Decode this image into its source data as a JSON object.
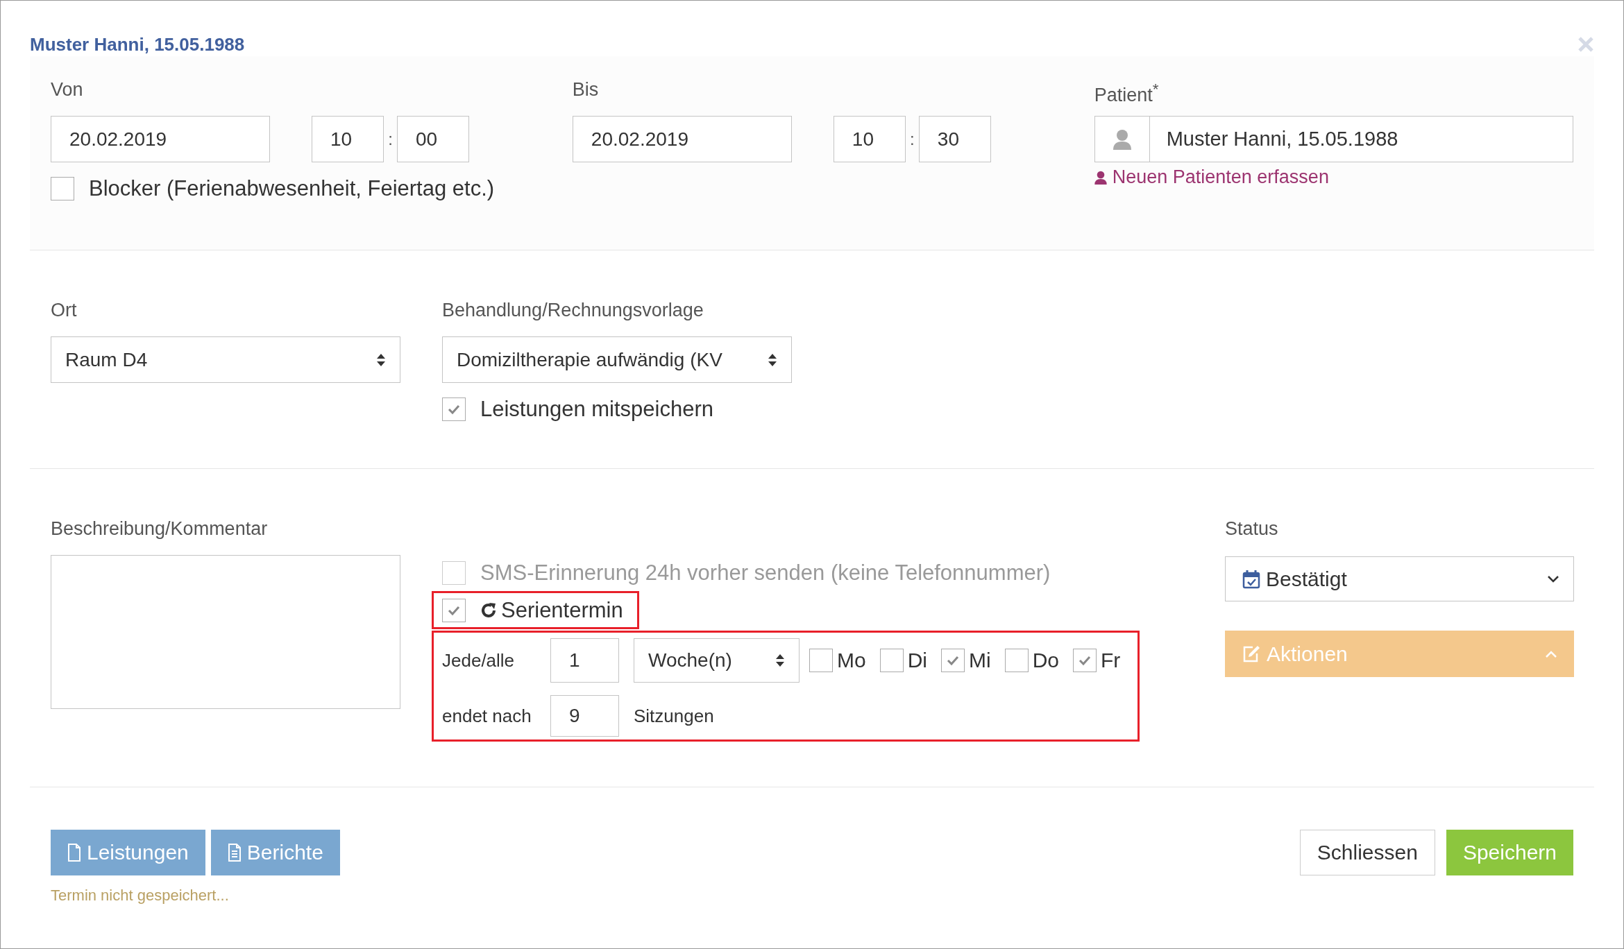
{
  "dialog": {
    "title": "Muster Hanni, 15.05.1988"
  },
  "von": {
    "label": "Von",
    "date": "20.02.2019",
    "hour": "10",
    "separator": ":",
    "minute": "00"
  },
  "bis": {
    "label": "Bis",
    "date": "20.02.2019",
    "hour": "10",
    "separator": ":",
    "minute": "30"
  },
  "patient": {
    "label": "Patient",
    "required_mark": "*",
    "value": "Muster Hanni, 15.05.1988",
    "new_patient_link": "Neuen Patienten erfassen"
  },
  "blocker": {
    "label": "Blocker (Ferienabwesenheit, Feiertag etc.)",
    "checked": false
  },
  "ort": {
    "label": "Ort",
    "value": "Raum D4"
  },
  "behandlung": {
    "label": "Behandlung/Rechnungsvorlage",
    "value": "Domiziltherapie aufwändig (KV"
  },
  "leistungen_mitspeichern": {
    "label": "Leistungen mitspeichern",
    "checked": true
  },
  "kommentar": {
    "label": "Beschreibung/Kommentar"
  },
  "sms": {
    "label": "SMS-Erinnerung 24h vorher senden (keine Telefonnummer)",
    "checked": false,
    "disabled": true
  },
  "serie": {
    "label": "Serientermin",
    "checked": true,
    "highlighted": true,
    "interval_label": "Jede/alle",
    "interval": "1",
    "unit": "Woche(n)",
    "days": [
      {
        "label": "Mo",
        "checked": false
      },
      {
        "label": "Di",
        "checked": false
      },
      {
        "label": "Mi",
        "checked": true
      },
      {
        "label": "Do",
        "checked": false
      },
      {
        "label": "Fr",
        "checked": true
      }
    ],
    "end_label": "endet nach",
    "count": "9",
    "count_unit": "Sitzungen"
  },
  "status": {
    "label": "Status",
    "value": "Bestätigt"
  },
  "aktionen": {
    "label": "Aktionen",
    "expanded": true
  },
  "footer": {
    "buttons": [
      {
        "label": "Leistungen",
        "kind": "document"
      },
      {
        "label": "Berichte",
        "kind": "report"
      }
    ],
    "note": "Termin nicht gespeichert...",
    "close": "Schliessen",
    "save": "Speichern"
  }
}
